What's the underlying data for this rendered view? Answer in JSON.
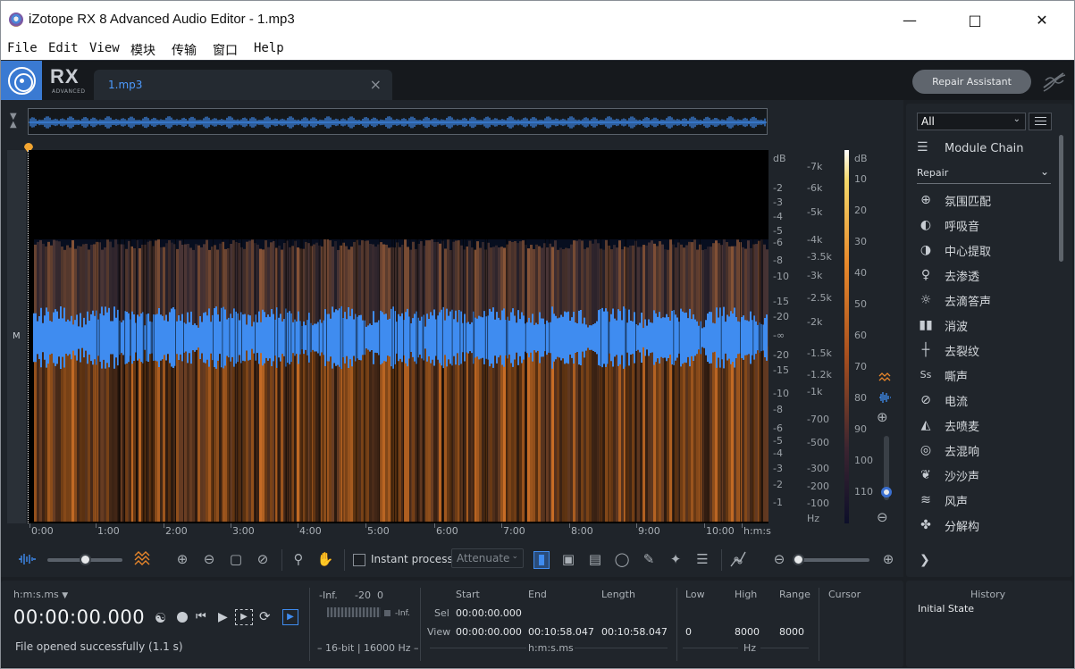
{
  "window": {
    "title": "iZotope RX 8 Advanced Audio Editor - 1.mp3"
  },
  "menu": [
    "File",
    "Edit",
    "View",
    "模块",
    "传输",
    "窗口",
    "Help"
  ],
  "header": {
    "logo_text": "RX",
    "logo_sub": "ADVANCED",
    "tab_label": "1.mp3",
    "repair_assistant": "Repair Assistant"
  },
  "spectrogram": {
    "channel_label": "M",
    "time_labels": [
      "0:00",
      "1:00",
      "2:00",
      "3:00",
      "4:00",
      "5:00",
      "6:00",
      "7:00",
      "8:00",
      "9:00",
      "10:00",
      "h:m:s"
    ],
    "db_labels": [
      "dB",
      "-2",
      "-3",
      "-4",
      "-5",
      "-6",
      "-8",
      "-10",
      "-15",
      "-20",
      "-∞",
      "-20",
      "-15",
      "-10",
      "-8",
      "-6",
      "-5",
      "-4",
      "-3",
      "-2",
      "-1"
    ],
    "hz_labels": [
      "-7k",
      "-6k",
      "-5k",
      "-4k",
      "-3.5k",
      "-3k",
      "-2.5k",
      "-2k",
      "-1.5k",
      "-1.2k",
      "-1k",
      "-700",
      "-500",
      "-300",
      "-200",
      "-100",
      "Hz"
    ],
    "color_db_labels": [
      "dB",
      "10",
      "20",
      "30",
      "40",
      "50",
      "60",
      "70",
      "80",
      "90",
      "100",
      "110"
    ]
  },
  "toolbar": {
    "instant_process": "Instant process",
    "attenuate": "Attenuate"
  },
  "panel": {
    "filter": "All",
    "module_chain": "Module Chain",
    "category": "Repair",
    "modules": [
      {
        "icon": "ambience-match-icon",
        "label": "氛围匹配"
      },
      {
        "icon": "breath-icon",
        "label": "呼吸音"
      },
      {
        "icon": "center-extract-icon",
        "label": "中心提取"
      },
      {
        "icon": "de-bleed-icon",
        "label": "去渗透"
      },
      {
        "icon": "de-click-icon",
        "label": "去滴答声"
      },
      {
        "icon": "de-clip-icon",
        "label": "消波"
      },
      {
        "icon": "de-crackle-icon",
        "label": "去裂纹"
      },
      {
        "icon": "de-ess-icon",
        "label": "嘶声"
      },
      {
        "icon": "de-hum-icon",
        "label": "电流"
      },
      {
        "icon": "de-plosive-icon",
        "label": "去喷麦"
      },
      {
        "icon": "de-reverb-icon",
        "label": "去混响"
      },
      {
        "icon": "de-rustle-icon",
        "label": "沙沙声"
      },
      {
        "icon": "de-wind-icon",
        "label": "风声"
      },
      {
        "icon": "deconstruct-icon",
        "label": "分解构"
      }
    ]
  },
  "status": {
    "time_format": "h:m:s.ms",
    "timecode": "00:00:00.000",
    "message": "File opened successfully (1.1 s)",
    "meter_labels": [
      "-Inf.",
      "-20",
      "0"
    ],
    "meter_inf": "-Inf.",
    "format": "16-bit | 16000 Hz",
    "sel_headers": [
      "Start",
      "End",
      "Length",
      "Low",
      "High",
      "Range",
      "Cursor"
    ],
    "sel_row": {
      "label": "Sel",
      "start": "00:00:00.000"
    },
    "view_row": {
      "label": "View",
      "start": "00:00:00.000",
      "end": "00:10:58.047",
      "length": "00:10:58.047",
      "low": "0",
      "high": "8000",
      "range": "8000"
    },
    "time_unit": "h:m:s.ms",
    "freq_unit": "Hz"
  },
  "history": {
    "title": "History",
    "item": "Initial State"
  },
  "colors": {
    "accent": "#4d9bff",
    "waveform": "#3f8cf0",
    "spectro_orange": "#e07a2a"
  }
}
